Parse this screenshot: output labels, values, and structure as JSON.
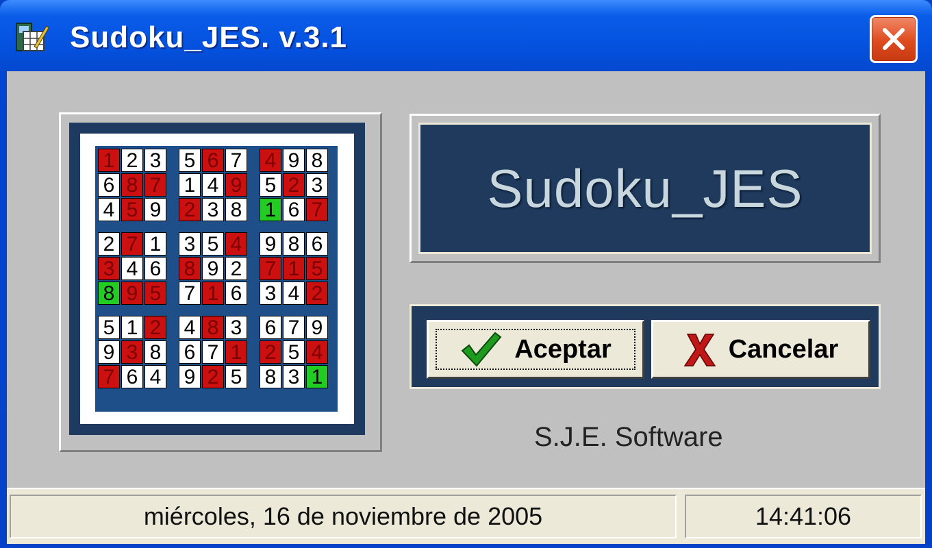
{
  "window": {
    "title": "Sudoku_JES. v.3.1",
    "app_icon": "sudoku-app-icon",
    "close_icon": "close-icon"
  },
  "banner": {
    "title": "Sudoku_JES"
  },
  "buttons": {
    "accept_label": "Aceptar",
    "accept_icon": "checkmark-icon",
    "cancel_label": "Cancelar",
    "cancel_icon": "x-cross-icon"
  },
  "company": "S.J.E. Software",
  "status": {
    "date": "miércoles, 16 de noviembre de 2005",
    "time": "14:41:06"
  },
  "colors": {
    "navy": "#1f3a5c",
    "red_cell": "#cc1010",
    "green_cell": "#22cc22",
    "panel": "#c0c0c0"
  },
  "sudoku": {
    "rows": [
      [
        "1",
        "2",
        "3",
        "5",
        "6",
        "7",
        "4",
        "9",
        "8"
      ],
      [
        "6",
        "8",
        "7",
        "1",
        "4",
        "9",
        "5",
        "2",
        "3"
      ],
      [
        "4",
        "5",
        "9",
        "2",
        "3",
        "8",
        "1",
        "6",
        "7"
      ],
      [
        "2",
        "7",
        "1",
        "3",
        "5",
        "4",
        "9",
        "8",
        "6"
      ],
      [
        "3",
        "4",
        "6",
        "8",
        "9",
        "2",
        "7",
        "1",
        "5"
      ],
      [
        "8",
        "9",
        "5",
        "7",
        "1",
        "6",
        "3",
        "4",
        "2"
      ],
      [
        "5",
        "1",
        "2",
        "4",
        "8",
        "3",
        "6",
        "7",
        "9"
      ],
      [
        "9",
        "3",
        "8",
        "6",
        "7",
        "1",
        "2",
        "5",
        "4"
      ],
      [
        "7",
        "6",
        "4",
        "9",
        "2",
        "5",
        "8",
        "3",
        "1"
      ]
    ],
    "highlight": [
      [
        "r",
        "w",
        "w",
        "w",
        "r",
        "w",
        "r",
        "w",
        "w"
      ],
      [
        "w",
        "r",
        "r",
        "w",
        "w",
        "r",
        "w",
        "r",
        "w"
      ],
      [
        "w",
        "r",
        "w",
        "r",
        "w",
        "w",
        "g",
        "w",
        "r"
      ],
      [
        "w",
        "r",
        "w",
        "w",
        "w",
        "r",
        "w",
        "w",
        "w"
      ],
      [
        "r",
        "w",
        "w",
        "r",
        "w",
        "w",
        "r",
        "r",
        "r"
      ],
      [
        "g",
        "r",
        "r",
        "w",
        "r",
        "w",
        "w",
        "w",
        "r"
      ],
      [
        "w",
        "w",
        "r",
        "w",
        "r",
        "w",
        "w",
        "w",
        "w"
      ],
      [
        "w",
        "r",
        "w",
        "w",
        "w",
        "r",
        "r",
        "w",
        "r"
      ],
      [
        "r",
        "w",
        "w",
        "w",
        "r",
        "w",
        "w",
        "w",
        "g"
      ]
    ]
  }
}
